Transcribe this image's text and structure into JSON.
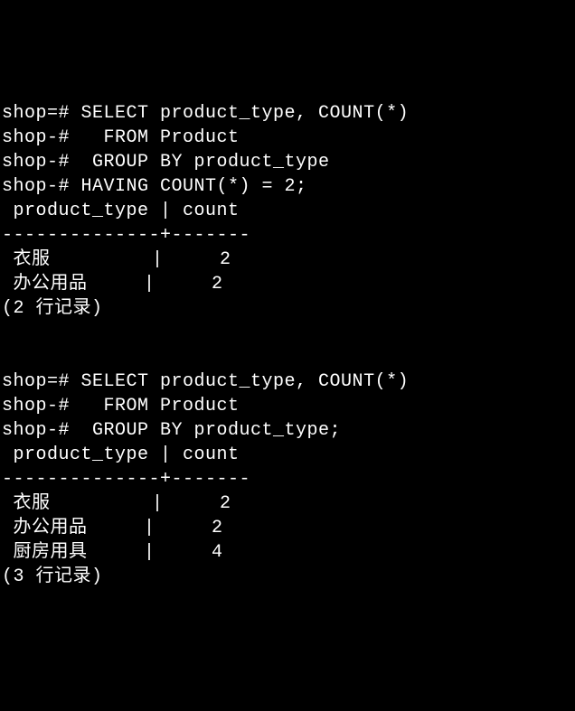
{
  "query1": {
    "line1": "shop=# SELECT product_type, COUNT(*)",
    "line2": "shop-#   FROM Product",
    "line3": "shop-#  GROUP BY product_type",
    "line4": "shop-# HAVING COUNT(*) = 2;",
    "header": " product_type | count",
    "divider": "--------------+-------",
    "row1": " 衣服         |     2",
    "row2": " 办公用品     |     2",
    "footer": "(2 行记录)"
  },
  "blank1": "",
  "blank2": "",
  "query2": {
    "line1": "shop=# SELECT product_type, COUNT(*)",
    "line2": "shop-#   FROM Product",
    "line3": "shop-#  GROUP BY product_type;",
    "header": " product_type | count",
    "divider": "--------------+-------",
    "row1": " 衣服         |     2",
    "row2": " 办公用品     |     2",
    "row3": " 厨房用具     |     4",
    "footer": "(3 行记录)"
  },
  "chart_data": [
    {
      "type": "table",
      "title": "SELECT product_type, COUNT(*) FROM Product GROUP BY product_type HAVING COUNT(*) = 2",
      "columns": [
        "product_type",
        "count"
      ],
      "rows": [
        [
          "衣服",
          2
        ],
        [
          "办公用品",
          2
        ]
      ],
      "row_count": 2
    },
    {
      "type": "table",
      "title": "SELECT product_type, COUNT(*) FROM Product GROUP BY product_type",
      "columns": [
        "product_type",
        "count"
      ],
      "rows": [
        [
          "衣服",
          2
        ],
        [
          "办公用品",
          2
        ],
        [
          "厨房用具",
          4
        ]
      ],
      "row_count": 3
    }
  ]
}
